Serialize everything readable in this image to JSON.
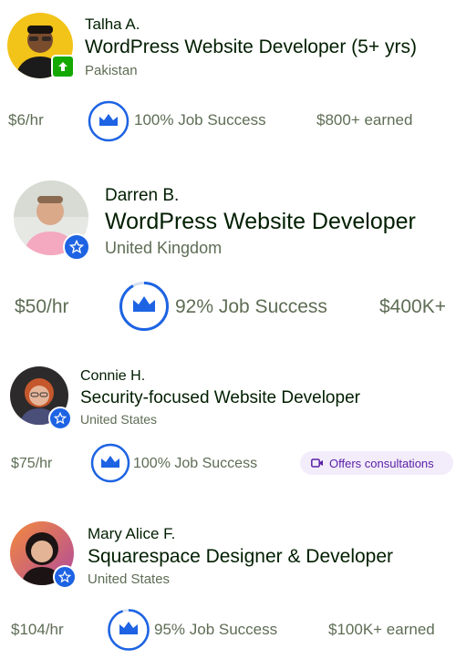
{
  "colors": {
    "text": "#001e00",
    "muted": "#5e6d55",
    "accent_blue": "#1d63e3",
    "rising_green": "#14a800",
    "pill_bg": "#f3ecfb",
    "pill_text": "#5a22a6"
  },
  "freelancers": [
    {
      "name": "Talha A.",
      "title": "WordPress Website Developer (5+ yrs)",
      "country": "Pakistan",
      "rate": "$6/hr",
      "job_success": "100% Job Success",
      "job_success_value": 100,
      "earned": "$800+ earned",
      "badge_icon": "rising-talent-arrow-icon"
    },
    {
      "name": "Darren B.",
      "title": "WordPress Website Developer",
      "country": "United Kingdom",
      "rate": "$50/hr",
      "job_success": "92% Job Success",
      "job_success_value": 92,
      "earned": "$400K+",
      "badge_icon": "top-rated-star-icon"
    },
    {
      "name": "Connie H.",
      "title": "Security-focused Website Developer",
      "country": "United States",
      "rate": "$75/hr",
      "job_success": "100% Job Success",
      "job_success_value": 100,
      "consult_label": "Offers consultations",
      "consult_icon": "video-camera-icon",
      "badge_icon": "top-rated-star-icon"
    },
    {
      "name": "Mary Alice F.",
      "title": "Squarespace Designer & Developer",
      "country": "United States",
      "rate": "$104/hr",
      "job_success": "95% Job Success",
      "job_success_value": 95,
      "earned": "$100K+ earned",
      "badge_icon": "top-rated-star-icon"
    }
  ]
}
